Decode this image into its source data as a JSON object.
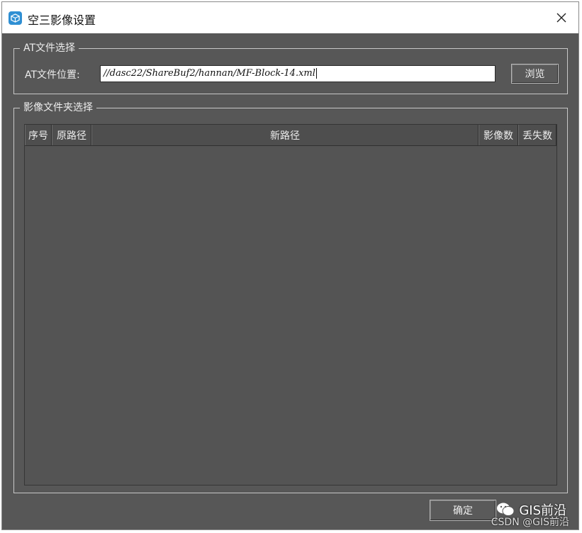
{
  "window": {
    "title": "空三影像设置"
  },
  "at_group": {
    "title": "AT文件选择",
    "field_label": "AT文件位置:",
    "path_value": "//dasc22/ShareBuf2/hannan/MF-Block-14.xml",
    "browse_label": "浏览"
  },
  "image_group": {
    "title": "影像文件夹选择",
    "columns": [
      "序号",
      "原路径",
      "新路径",
      "影像数",
      "丢失数"
    ],
    "rows": []
  },
  "footer": {
    "ok_label": "确定"
  },
  "watermark": {
    "brand": "GIS前沿",
    "credit": "CSDN @GIS前沿"
  }
}
